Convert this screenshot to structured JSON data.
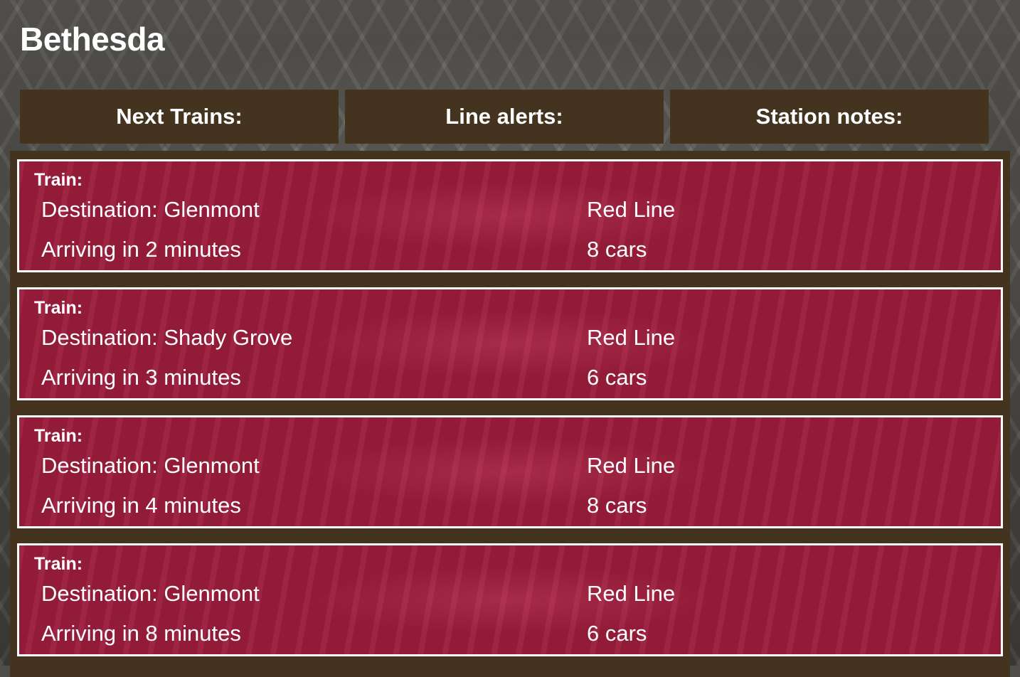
{
  "station": {
    "name": "Bethesda"
  },
  "tabs": [
    {
      "label": "Next Trains:"
    },
    {
      "label": "Line alerts:"
    },
    {
      "label": "Station notes:"
    }
  ],
  "trains": [
    {
      "label": "Train:",
      "destination": "Destination: Glenmont",
      "arrival": "Arriving in 2 minutes",
      "line": "Red Line",
      "cars": "8 cars"
    },
    {
      "label": "Train:",
      "destination": "Destination: Shady Grove",
      "arrival": "Arriving in 3 minutes",
      "line": "Red Line",
      "cars": "6 cars"
    },
    {
      "label": "Train:",
      "destination": "Destination: Glenmont",
      "arrival": "Arriving in 4 minutes",
      "line": "Red Line",
      "cars": "8 cars"
    },
    {
      "label": "Train:",
      "destination": "Destination: Glenmont",
      "arrival": "Arriving in 8 minutes",
      "line": "Red Line",
      "cars": "6 cars"
    }
  ],
  "colors": {
    "tab_background": "#43331f",
    "card_background": "#9a1c3b",
    "card_border": "#ffffff",
    "text": "#ffffff"
  }
}
